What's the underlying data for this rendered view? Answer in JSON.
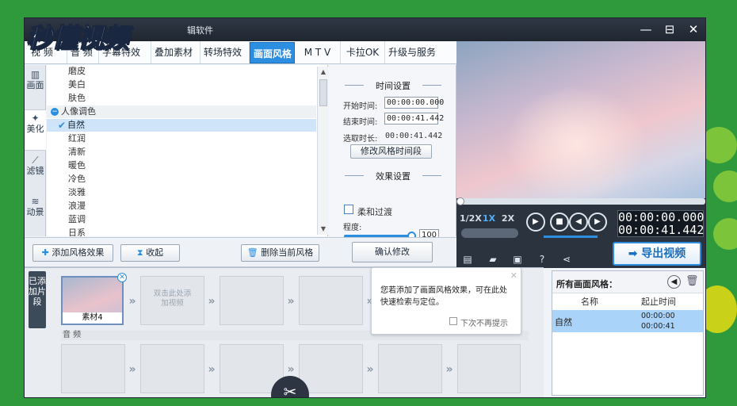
{
  "app": {
    "title": "辑软件",
    "logo": "秒懂视频"
  },
  "window_controls": {
    "minimize": "—",
    "maximize": "⊟",
    "close": "✕"
  },
  "tabs": [
    {
      "label": "视 频"
    },
    {
      "label": "音 频"
    },
    {
      "label": "字幕特效"
    },
    {
      "label": "叠加素材"
    },
    {
      "label": "转场特效"
    },
    {
      "label": "画面风格",
      "active": true
    },
    {
      "label": "M T V"
    },
    {
      "label": "卡拉OK"
    },
    {
      "label": "升级与服务"
    }
  ],
  "side_tabs": [
    {
      "label": "画面",
      "icon": "image-icon"
    },
    {
      "label": "美化",
      "icon": "magic-wand-icon"
    },
    {
      "label": "滤镜",
      "icon": "wand-icon"
    },
    {
      "label": "动景",
      "icon": "wave-icon"
    }
  ],
  "style_list": {
    "items": [
      {
        "label": "磨皮"
      },
      {
        "label": "美白"
      },
      {
        "label": "肤色"
      },
      {
        "label": "人像调色",
        "category": true
      },
      {
        "label": "自然",
        "selected": true
      },
      {
        "label": "红润"
      },
      {
        "label": "清新"
      },
      {
        "label": "暖色"
      },
      {
        "label": "冷色"
      },
      {
        "label": "淡雅"
      },
      {
        "label": "浪漫"
      },
      {
        "label": "蓝调"
      },
      {
        "label": "日系"
      }
    ]
  },
  "settings": {
    "time_title": "时间设置",
    "start_label": "开始时间:",
    "start_value": "00:00:00.000",
    "end_label": "结束时间:",
    "end_value": "00:00:41.442",
    "duration_label": "选取时长:",
    "duration_value": "00:00:41.442",
    "modify_time_button": "修改风格时间段",
    "effect_title": "效果设置",
    "smooth_label": "柔和过渡",
    "degree_label": "程度:",
    "degree_value": "100",
    "degree_level_percent": 100
  },
  "bottombar": {
    "add_effect": "添加风格效果",
    "collapse": "收起",
    "delete_current": "删除当前风格",
    "confirm": "确认修改"
  },
  "player": {
    "speeds": [
      "1/2X",
      "1X",
      "2X"
    ],
    "active_speed": "1X",
    "current_time": "00:00:00.000",
    "total_time": "00:00:41.442",
    "export": "导出视频"
  },
  "timeline": {
    "track_label": "已添加片段",
    "clip_name": "素材4",
    "add_placeholder": "双击此处添加视频",
    "audio_label": "音 频"
  },
  "tooltip": {
    "text": "您若添加了画面风格效果，可在此处快速检索与定位。",
    "dont_show": "下次不再提示"
  },
  "right_panel": {
    "title": "所有画面风格：",
    "col_name": "名称",
    "col_time": "起止时间",
    "rows": [
      {
        "name": "自然",
        "start": "00:00:00",
        "end": "00:00:41"
      }
    ]
  }
}
